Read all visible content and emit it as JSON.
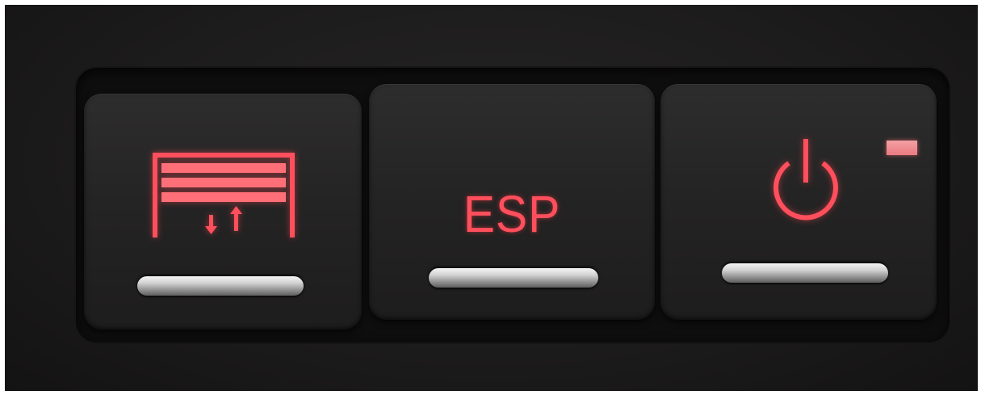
{
  "buttons": [
    {
      "id": "garage-door",
      "icon": "garage-door-icon"
    },
    {
      "id": "esp",
      "label": "ESP"
    },
    {
      "id": "power",
      "icon": "power-icon",
      "indicator": "status-led"
    }
  ],
  "colors": {
    "illumination": "#ff4f5c",
    "led": "#ea7e83",
    "button_face": "#262525",
    "chrome": "#c8c8c8"
  }
}
